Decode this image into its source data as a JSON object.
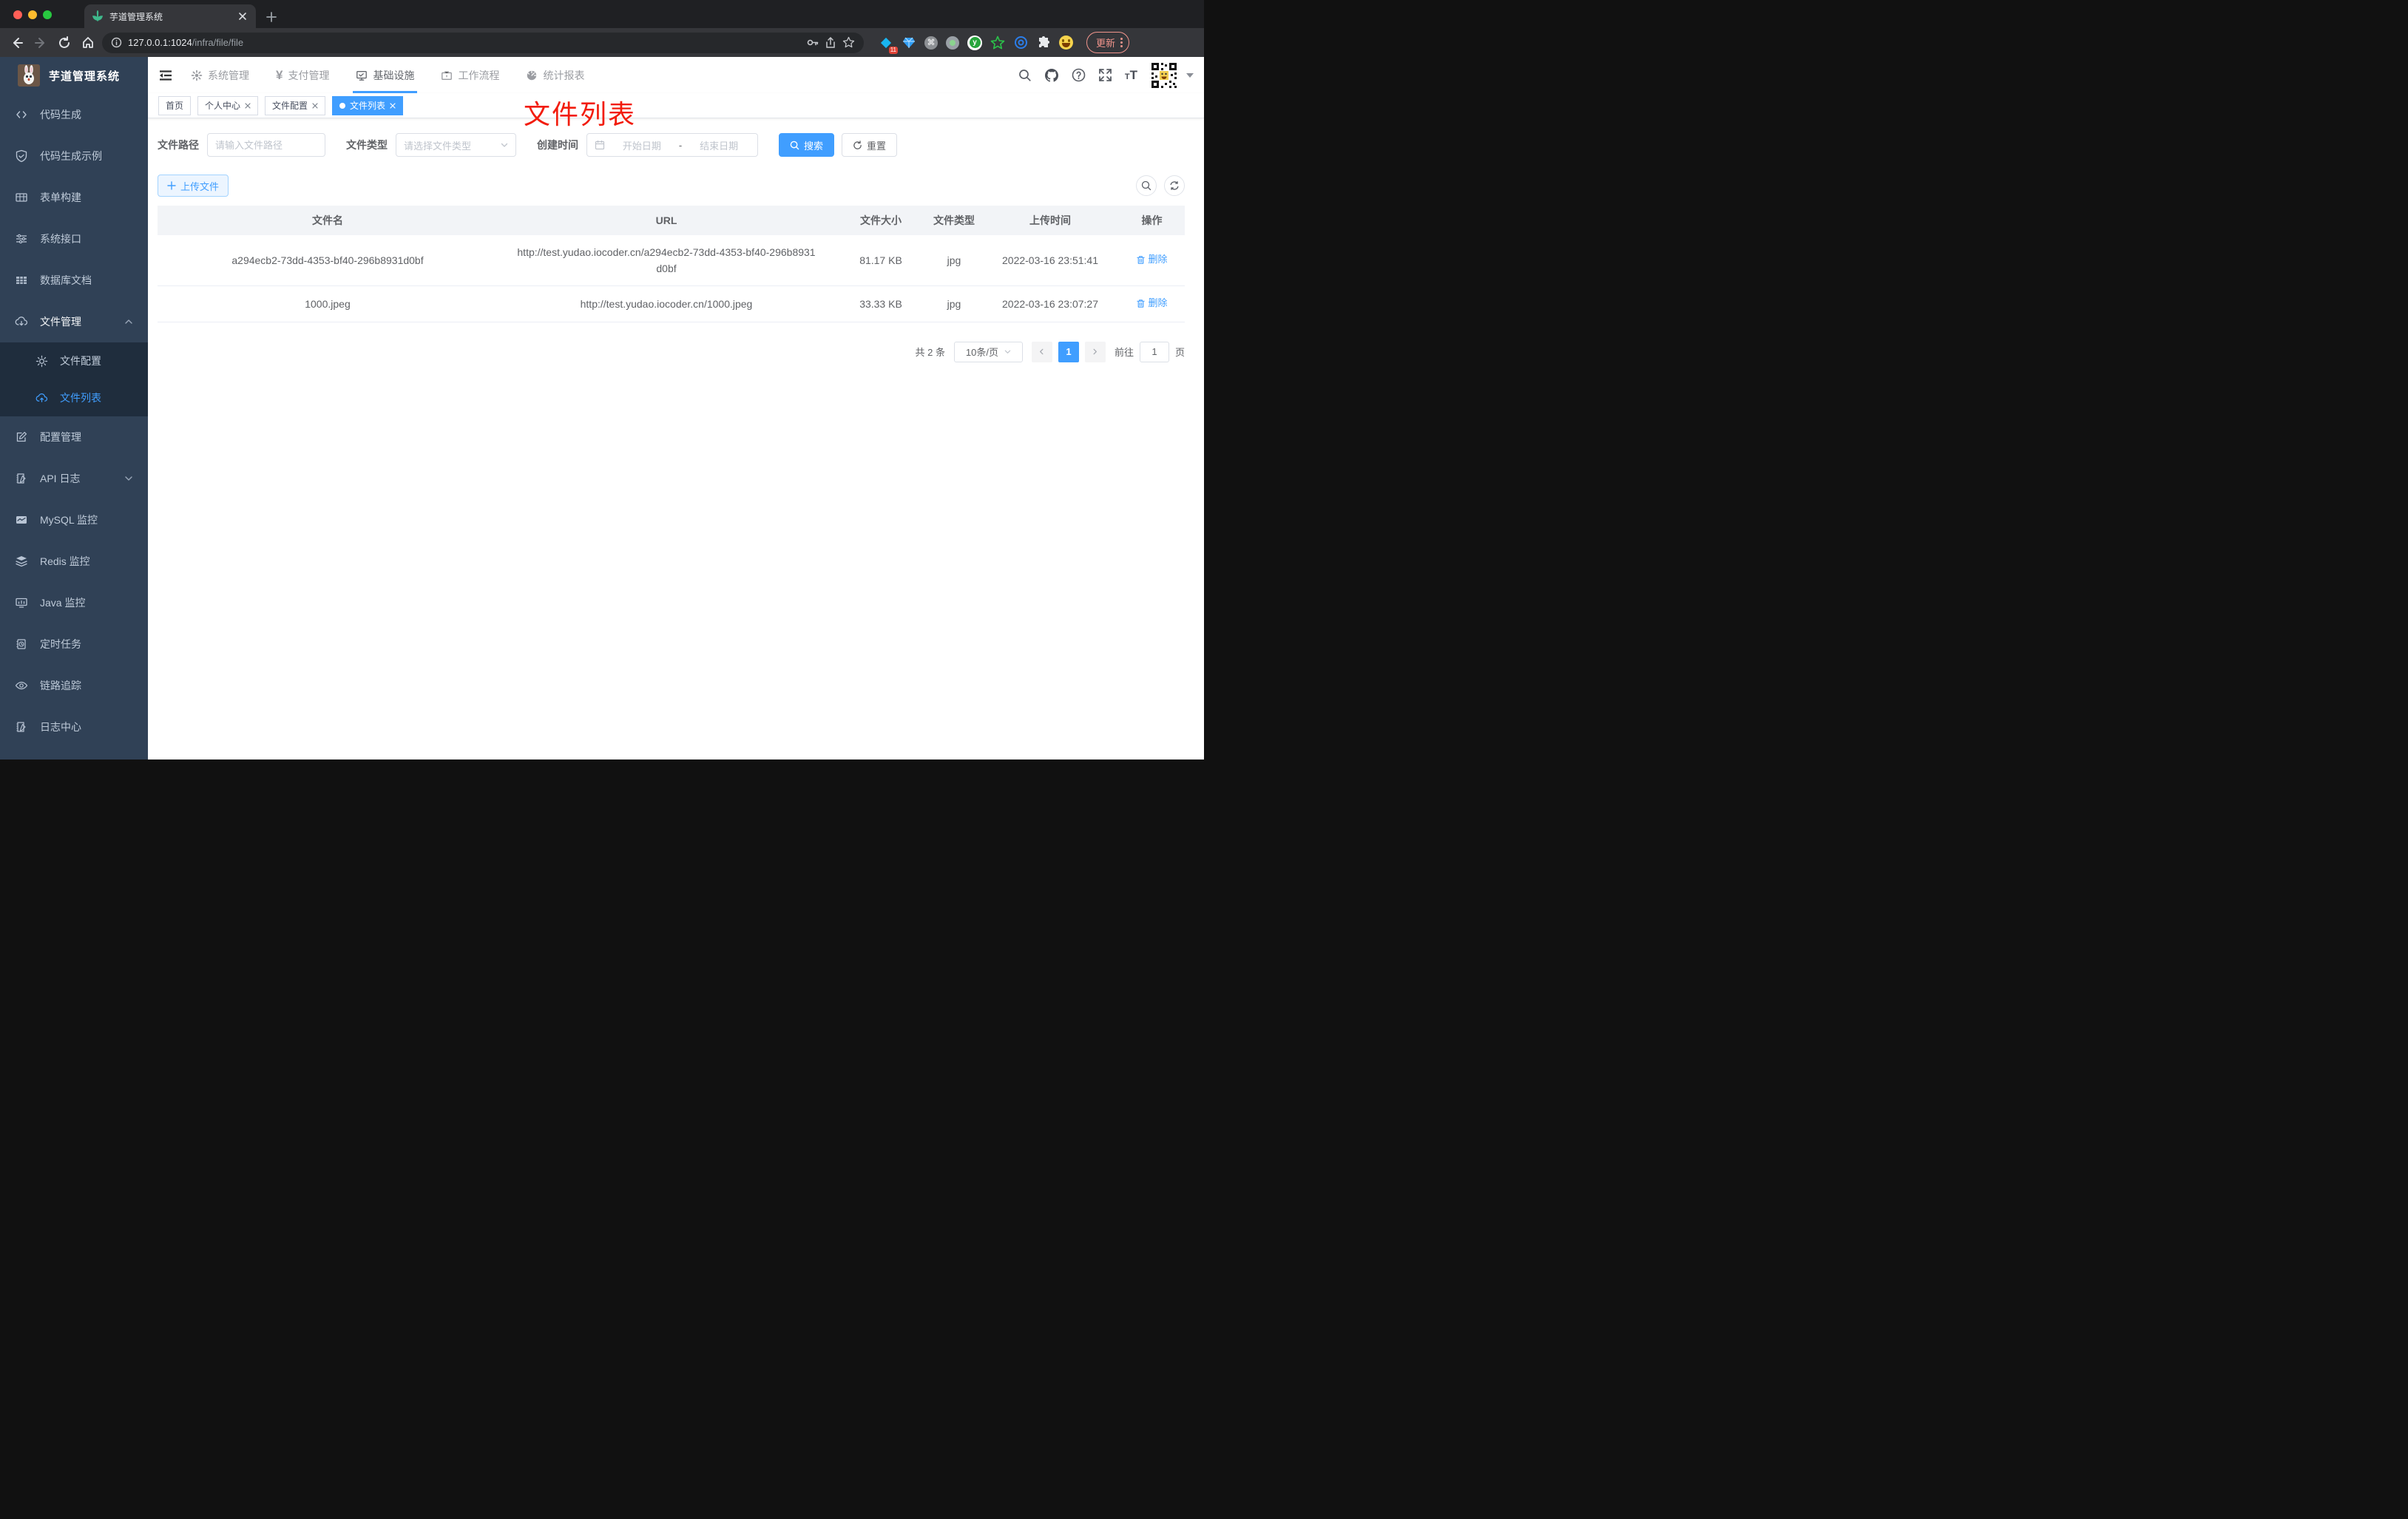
{
  "browser": {
    "tab_title": "芋道管理系统",
    "url_host": "127.0.0.1:1024",
    "url_path": "/infra/file/file",
    "update_label": "更新",
    "extensions_badge": "11",
    "icons": {
      "command_glyph": "⌘",
      "y_glyph": "y",
      "help_glyph": "?",
      "font_glyph": "T"
    }
  },
  "sidebar": {
    "logo_title": "芋道管理系统",
    "items": [
      {
        "label": "代码生成"
      },
      {
        "label": "代码生成示例"
      },
      {
        "label": "表单构建"
      },
      {
        "label": "系统接口"
      },
      {
        "label": "数据库文档"
      },
      {
        "label": "文件管理",
        "expanded": true,
        "children": [
          {
            "label": "文件配置"
          },
          {
            "label": "文件列表",
            "active": true
          }
        ]
      },
      {
        "label": "配置管理"
      },
      {
        "label": "API 日志"
      },
      {
        "label": "MySQL 监控"
      },
      {
        "label": "Redis 监控"
      },
      {
        "label": "Java 监控"
      },
      {
        "label": "定时任务"
      },
      {
        "label": "链路追踪"
      },
      {
        "label": "日志中心"
      }
    ]
  },
  "topnav": {
    "menus": [
      {
        "label": "系统管理"
      },
      {
        "label": "支付管理",
        "glyph": "¥"
      },
      {
        "label": "基础设施",
        "active": true
      },
      {
        "label": "工作流程"
      },
      {
        "label": "统计报表"
      }
    ]
  },
  "tags": [
    {
      "label": "首页",
      "closable": false
    },
    {
      "label": "个人中心",
      "closable": true
    },
    {
      "label": "文件配置",
      "closable": true
    },
    {
      "label": "文件列表",
      "closable": true,
      "active": true
    }
  ],
  "annotation": "文件列表",
  "filters": {
    "path_label": "文件路径",
    "path_placeholder": "请输入文件路径",
    "type_label": "文件类型",
    "type_placeholder": "请选择文件类型",
    "time_label": "创建时间",
    "start_placeholder": "开始日期",
    "range_separator": "-",
    "end_placeholder": "结束日期",
    "search_label": "搜索",
    "reset_label": "重置"
  },
  "toolbar": {
    "upload_label": "上传文件"
  },
  "table": {
    "headers": [
      "文件名",
      "URL",
      "文件大小",
      "文件类型",
      "上传时间",
      "操作"
    ],
    "rows": [
      {
        "name": "a294ecb2-73dd-4353-bf40-296b8931d0bf",
        "url": "http://test.yudao.iocoder.cn/a294ecb2-73dd-4353-bf40-296b8931d0bf",
        "size": "81.17 KB",
        "type": "jpg",
        "time": "2022-03-16 23:51:41",
        "action": "删除"
      },
      {
        "name": "1000.jpeg",
        "url": "http://test.yudao.iocoder.cn/1000.jpeg",
        "size": "33.33 KB",
        "type": "jpg",
        "time": "2022-03-16 23:07:27",
        "action": "删除"
      }
    ]
  },
  "pagination": {
    "total": "共 2 条",
    "page_size": "10条/页",
    "page": "1",
    "goto_label": "前往",
    "goto_value": "1",
    "unit_label": "页"
  }
}
